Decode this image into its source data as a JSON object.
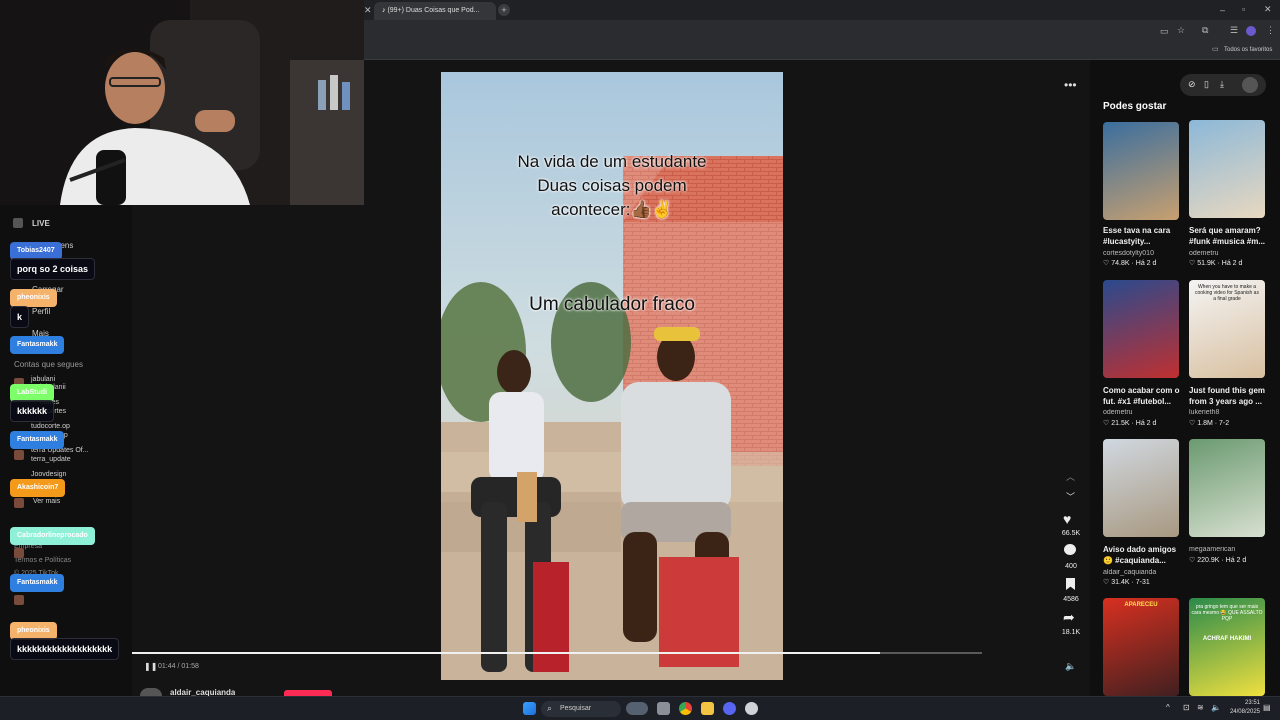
{
  "browser": {
    "tab_title": "(99+) Duas Coisas que Pod...",
    "bookmarks_label": "Todos os favoritos"
  },
  "sidebar": {
    "live_label": "LIVE",
    "items": [
      "Mensagens",
      "Carregar",
      "Perfil",
      "Mais"
    ],
    "following_header": "Contas que segues",
    "following": [
      "jabulani",
      "jabulanii",
      "cortes",
      "ckcortes",
      "tudocorte.op",
      "op",
      "terra Updates Of...",
      "terra_update",
      "Joovdesign",
      "Ver mais"
    ],
    "footer": [
      "Empresa",
      "Termos e Políticas",
      "© 2025 TikTok"
    ]
  },
  "chat": [
    {
      "user": "Tobias2407",
      "message": "porq so 2 coisas",
      "color": "#3a6fd8"
    },
    {
      "user": "pheonixis",
      "message": "k",
      "color": "#f5b26b"
    },
    {
      "user": "Fantasmakk",
      "message": "",
      "color": "#2f7fe0"
    },
    {
      "user": "LabStudi",
      "message": "kkkkkk",
      "color": "#7dff6a"
    },
    {
      "user": "Fantasmakk",
      "message": "",
      "color": "#2f7fe0"
    },
    {
      "user": "Akashicoin7",
      "message": "",
      "color": "#f39a1b"
    },
    {
      "user": "Cabradorlineprocado",
      "message": "",
      "color": "#8ff0d8"
    },
    {
      "user": "Fantasmakk",
      "message": "",
      "color": "#2f7fe0"
    },
    {
      "user": "pheonixis",
      "message": "kkkkkkkkkkkkkkkkkkk",
      "color": "#f5b26b"
    }
  ],
  "video": {
    "caption_top": [
      "Na vida de um estudante",
      "Duas coisas podem",
      "acontecer:👍🏾✌"
    ],
    "caption_mid": "Um cabulador fraco",
    "time": "01:44 / 01:58",
    "progress": 0.88,
    "author": "aldair_caquianda",
    "likes": "66.5K",
    "comments": "400",
    "saves": "4586",
    "shares": "18.1K"
  },
  "recs": {
    "header": "Podes gostar",
    "items": [
      {
        "title": "Esse tava na cara #lucastyity...",
        "author": "cortesdotylty010",
        "likes": "74.8K",
        "date": "Há 2 d",
        "colors": [
          "#3a6e9e",
          "#c8a070"
        ]
      },
      {
        "title": "Será que amaram? #funk #musica #m...",
        "author": "odemetru",
        "likes": "51.9K",
        "date": "Há 2 d",
        "colors": [
          "#8cb8d8",
          "#e8d8c0"
        ]
      },
      {
        "title": "Como acabar com o fut. #x1 #futebol...",
        "author": "odemetru",
        "likes": "21.5K",
        "date": "Há 2 d",
        "colors": [
          "#2a4a8e",
          "#c03030"
        ]
      },
      {
        "title": "Just found this gem from 3 years ago ...",
        "author": "lukerieth8",
        "likes": "1.8M",
        "date": "7-2",
        "colors": [
          "#f4f4f4",
          "#d8c0a0"
        ]
      },
      {
        "title": "Aviso dado amigos 🙂 #caquianda...",
        "author": "aldair_caquianda",
        "likes": "31.4K",
        "date": "7-31",
        "colors": [
          "#d0d8e0",
          "#a89880"
        ]
      },
      {
        "title": "",
        "author": "megaamerican",
        "likes": "220.9K",
        "date": "Há 2 d",
        "colors": [
          "#6a9a70",
          "#d8e0d0"
        ]
      },
      {
        "title": "",
        "author": "",
        "likes": "",
        "date": "",
        "colors": [
          "#d83020",
          "#402020"
        ]
      },
      {
        "title": "",
        "author": "",
        "likes": "",
        "date": "",
        "colors": [
          "#2a8a4a",
          "#f0e040"
        ]
      }
    ],
    "thumb4_text": "When you have to make a cooking video for Spanish as a final grade",
    "thumb8_text": "pra gringo tem que ser mais cara mesmo 😂 QUE ASSALTO PQP",
    "thumb8_sub": "ACHRAF HAKIMI",
    "thumb7_text": "APARECEU"
  },
  "taskbar": {
    "search_label": "Pesquisar",
    "time": "23:51",
    "date": "24/08/2025"
  }
}
